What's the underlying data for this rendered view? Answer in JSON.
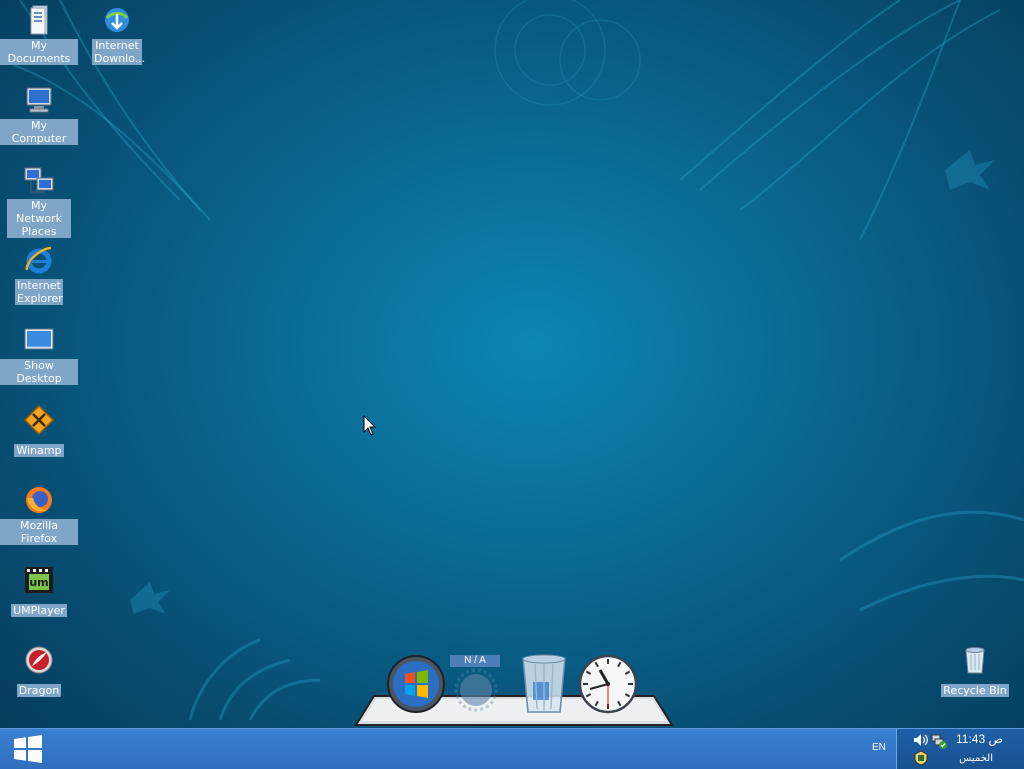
{
  "desktop": {
    "icons": [
      {
        "label": "My Documents",
        "icon": "documents-icon"
      },
      {
        "label": "Internet Downlo...",
        "icon": "idm-icon"
      },
      {
        "label": "My Computer",
        "icon": "computer-icon"
      },
      {
        "label": "My Network Places",
        "icon": "network-icon"
      },
      {
        "label": "Internet Explorer",
        "icon": "ie-icon"
      },
      {
        "label": "Show Desktop",
        "icon": "show-desktop-icon"
      },
      {
        "label": "Winamp",
        "icon": "winamp-icon"
      },
      {
        "label": "Mozilla Firefox",
        "icon": "firefox-icon"
      },
      {
        "label": "UMPlayer",
        "icon": "umplayer-icon"
      },
      {
        "label": "Dragon",
        "icon": "dragon-icon"
      },
      {
        "label": "Recycle Bin",
        "icon": "recycle-bin-icon"
      }
    ]
  },
  "dock": {
    "weather_label": "N / A",
    "items": [
      "windows-orb-icon",
      "weather-icon",
      "trash-icon",
      "clock-icon"
    ]
  },
  "taskbar": {
    "language": "EN",
    "clock": {
      "time": "ص 11:43",
      "day": "الخميس"
    },
    "tray_icons": [
      "volume-icon",
      "network-tray-icon",
      "security-tray-icon"
    ]
  },
  "colors": {
    "desktop_center": "#0d86b3",
    "desktop_edge": "#053a58",
    "taskbar": "#3a7fd0",
    "label_bg": "#7fa6c8"
  }
}
